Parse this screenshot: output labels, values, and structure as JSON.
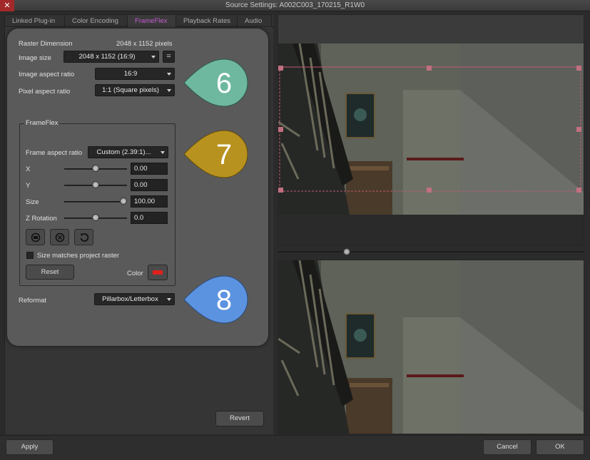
{
  "window": {
    "title": "Source Settings: A002C003_170215_R1W0"
  },
  "tabs": [
    {
      "label": "Linked Plug-in"
    },
    {
      "label": "Color Encoding"
    },
    {
      "label": "FrameFlex"
    },
    {
      "label": "Playback Rates"
    },
    {
      "label": "Audio"
    }
  ],
  "raster": {
    "dimension_label": "Raster Dimension",
    "dimension_value": "2048 x 1152 pixels",
    "image_size_label": "Image size",
    "image_size_value": "2048 x 1152 (16:9)",
    "equals_label": "=",
    "aspect_label": "Image aspect ratio",
    "aspect_value": "16:9",
    "pixel_aspect_label": "Pixel aspect ratio",
    "pixel_aspect_value": "1:1 (Square pixels)"
  },
  "frameflex": {
    "group_title": "FrameFlex",
    "frame_aspect_label": "Frame aspect ratio",
    "frame_aspect_value": "Custom (2.39:1)...",
    "x_label": "X",
    "x_value": "0.00",
    "x_level": 0.5,
    "y_label": "Y",
    "y_value": "0.00",
    "y_level": 0.5,
    "size_label": "Size",
    "size_value": "100.00",
    "size_level": 1.0,
    "zrot_label": "Z Rotation",
    "zrot_value": "0.0",
    "zrot_level": 0.5,
    "icons": [
      "rotate-90-icon",
      "rotate-reset-icon",
      "rotate-ccw-icon"
    ],
    "checkbox_label": "Size matches project raster",
    "checkbox_checked": false,
    "reset_label": "Reset",
    "color_label": "Color",
    "color_value": "#e0201a"
  },
  "reformat": {
    "label": "Reformat",
    "value": "Pillarbox/Letterbox"
  },
  "callouts": [
    {
      "number": "6",
      "color": "#6fb8a0"
    },
    {
      "number": "7",
      "color": "#b8921e"
    },
    {
      "number": "8",
      "color": "#5b93e0"
    }
  ],
  "revert_label": "Revert",
  "bottom": {
    "apply_label": "Apply",
    "cancel_label": "Cancel",
    "ok_label": "OK"
  },
  "preview": {
    "scrubber_level": 0.22,
    "frame_outline_color": "#c05a70"
  }
}
